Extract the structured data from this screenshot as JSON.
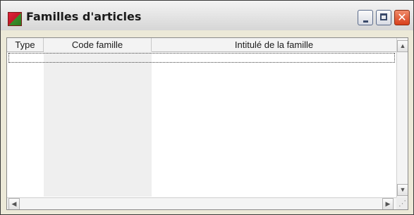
{
  "window": {
    "title": "Familles d'articles",
    "icon": "app-icon"
  },
  "controls": {
    "minimize": "minimize-icon",
    "maximize": "maximize-icon",
    "close_glyph": "✕"
  },
  "table": {
    "columns": [
      "Type",
      "Code famille",
      "Intitulé de la famille"
    ],
    "rows": []
  },
  "scrollbars": {
    "up": "▲",
    "down": "▼",
    "left": "◀",
    "right": "▶",
    "grip": "⋰"
  }
}
